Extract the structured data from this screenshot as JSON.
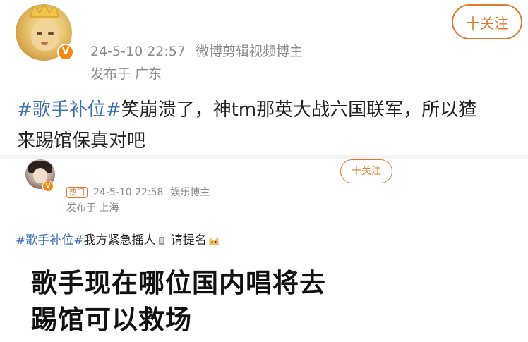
{
  "post1": {
    "time": "24-5-10 22:57",
    "tag": "微博剪辑视频博主",
    "location": "发布于 广东",
    "follow_label": "十关注",
    "topic": "#歌手补位#",
    "text_line1": "笑崩溃了，神tm那英大战六国联军，所以猹",
    "text_line2": "来踢馆保真对吧"
  },
  "post2": {
    "hot_label": "热门",
    "time": "24-5-10 22:58",
    "tag": "娱乐博主",
    "location": "发布于 上海",
    "follow_label": "十关注",
    "topic1": "#歌手补位#",
    "text_a": "我方紧急摇人",
    "text_b": " 请提名",
    "big_line1": "歌手现在哪位国内唱将去",
    "big_line2": "踢馆可以救场"
  },
  "colors": {
    "accent": "#e07a2e",
    "topic": "#3a6fb5",
    "meta": "#8a8a8a",
    "verified": "#f08a10"
  },
  "icons": {
    "verified_badge": "V",
    "emoji_1": "candle-emoji",
    "emoji_2": "cat-emoji"
  }
}
